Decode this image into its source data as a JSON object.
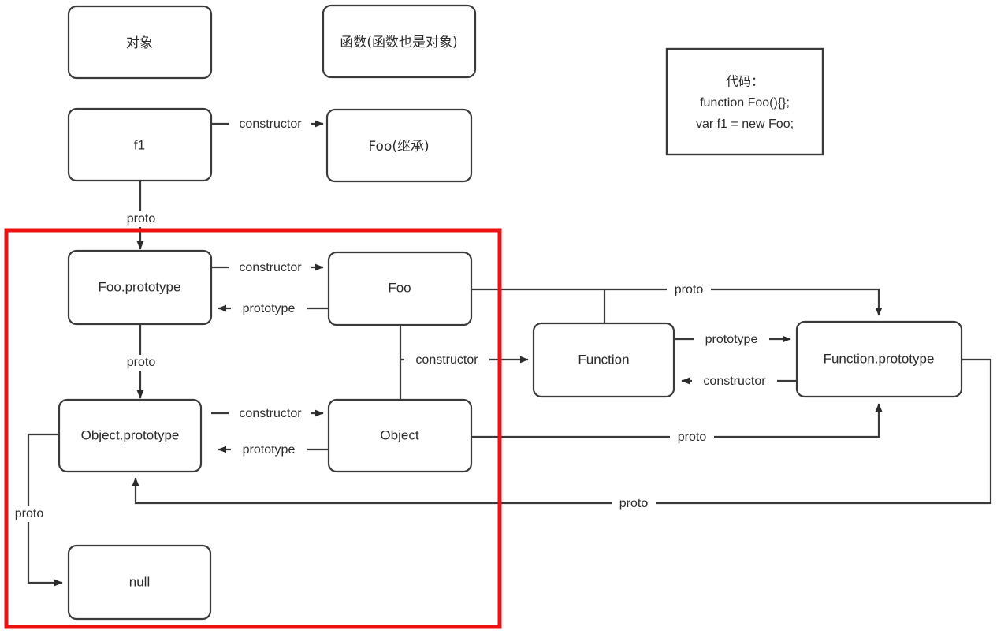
{
  "diagram": {
    "title_nodes": {
      "object_group": "对象",
      "function_group": "函数(函数也是对象)"
    },
    "code_box": {
      "line1": "代码：",
      "line2": "function Foo(){};",
      "line3": "var  f1  =  new  Foo;"
    },
    "nodes": {
      "f1": "f1",
      "foo_inherit": "Foo(继承)",
      "foo_prototype": "Foo.prototype",
      "foo": "Foo",
      "object_prototype": "Object.prototype",
      "object": "Object",
      "function": "Function",
      "function_prototype": "Function.prototype",
      "null": "null"
    },
    "edge_labels": {
      "f1_to_foo": "constructor",
      "f1_to_fooproto": "proto",
      "fooproto_to_foo": "constructor",
      "foo_to_fooproto": "prototype",
      "fooproto_to_objproto": "proto",
      "foo_to_function": "constructor",
      "foo_to_funcproto": "proto",
      "objproto_to_object": "constructor",
      "object_to_objproto": "prototype",
      "object_to_funcproto": "proto",
      "function_to_funcproto": "prototype",
      "funcproto_to_function": "constructor",
      "funcproto_to_objproto": "proto",
      "objproto_to_null": "proto"
    },
    "colors": {
      "highlight_border": "#ee1111",
      "node_stroke": "#3a3a3a",
      "node_fill": "#ffffff",
      "text": "#2b2b2b"
    }
  }
}
